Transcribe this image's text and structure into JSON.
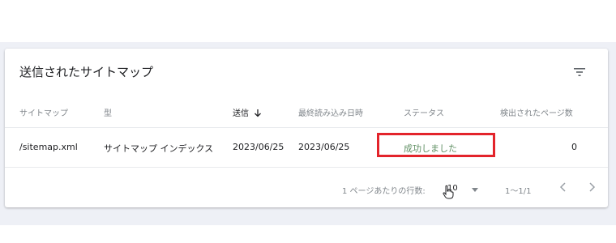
{
  "card": {
    "title": "送信されたサイトマップ",
    "filter_icon": "filter-icon"
  },
  "table": {
    "headers": [
      "サイトマップ",
      "型",
      "送信",
      "最終読み込み日時",
      "ステータス",
      "検出されたページ数"
    ],
    "sorted_column": "送信",
    "sort_direction": "descending",
    "rows": [
      {
        "sitemap": "/sitemap.xml",
        "type": "サイトマップ インデックス",
        "submitted": "2023/06/25",
        "last_read": "2023/06/25",
        "status": "成功しました",
        "pages": "0"
      }
    ]
  },
  "footer": {
    "rows_per_page_label": "1 ページあたりの行数:",
    "rows_per_page_value": "10",
    "range": "1〜1/1",
    "prev_icon": "chevron-left-icon",
    "next_icon": "chevron-right-icon"
  },
  "colors": {
    "status_success": "#5f8f63",
    "highlight": "#e3242b"
  }
}
